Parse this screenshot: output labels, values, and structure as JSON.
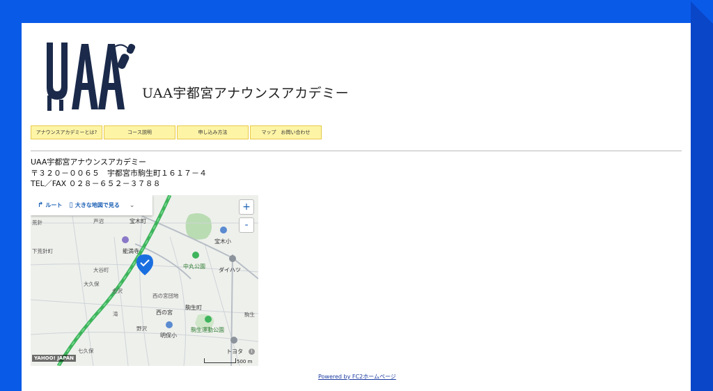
{
  "site": {
    "title": "UAA宇都宮アナウンスアカデミー",
    "logo_text": "UAA"
  },
  "nav": {
    "items": [
      {
        "label": "アナウンスアカデミーとは?"
      },
      {
        "label": "コース説明"
      },
      {
        "label": "申し込み方法"
      },
      {
        "label": "マップ　お問い合わせ"
      }
    ]
  },
  "contact": {
    "name": "UAA宇都宮アナウンスアカデミー",
    "address": "〒３２０－００６５　宇都宮市駒生町１６１７－４",
    "tel_fax": "TEL／FAX ０２８－６５２－３７８８"
  },
  "map": {
    "toolbar": {
      "route_label": "ルート",
      "big_map_label": "大きな地図で見る"
    },
    "zoom_in": "+",
    "zoom_out": "-",
    "labels": {
      "l1": "宝木町",
      "l2": "能満寺",
      "l3": "宝木小",
      "l4": "中丸公園",
      "l5": "ダイハツ",
      "l6": "下荒針町",
      "l7": "大谷町",
      "l8": "大久保",
      "l9": "金沢",
      "l10": "西の宮団地",
      "l11": "駒生町",
      "l12": "西の宮",
      "l13": "駒生",
      "l14": "駒生運動公園",
      "l15": "明保小",
      "l16": "野沢",
      "l17": "七久保",
      "l18": "トヨタ",
      "l19": "芦沼",
      "l20": "荒針",
      "l21": "滝"
    },
    "provider": "YAHOO! JAPAN",
    "scale_label": "500 m",
    "colors": {
      "highway": "#4fc46a",
      "marker": "#1a6fe0",
      "park": "#b9dcb2"
    }
  },
  "footer": {
    "powered_by": "Powered by FC2ホームページ"
  }
}
